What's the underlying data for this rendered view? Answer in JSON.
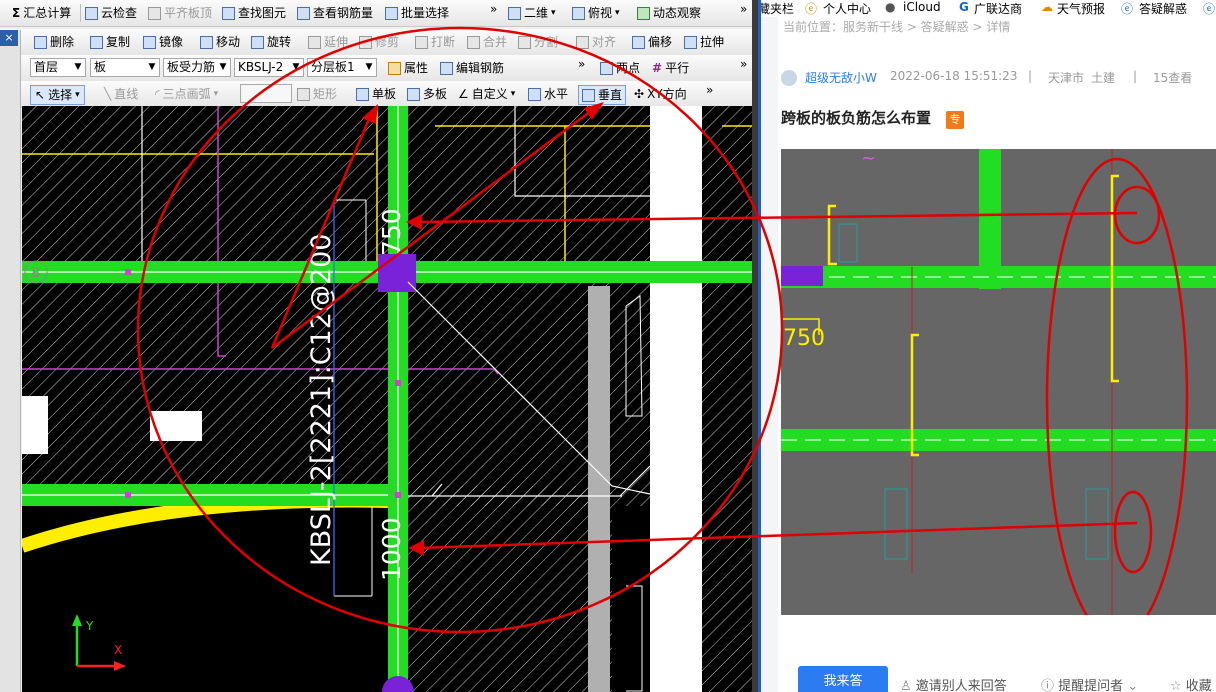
{
  "toolbar1": {
    "items": [
      "汇总计算",
      "云检查",
      "平齐板顶",
      "查找图元",
      "查看钢筋量",
      "批量选择",
      "二维",
      "俯视",
      "动态观察"
    ],
    "sigma": "Σ",
    "chevron": "»"
  },
  "toolbar2": {
    "items": [
      "删除",
      "复制",
      "镜像",
      "移动",
      "旋转",
      "延伸",
      "修剪",
      "打断",
      "合并",
      "分割",
      "对齐",
      "偏移",
      "拉伸"
    ]
  },
  "toolbar3": {
    "floor": "首层",
    "type": "板",
    "rebar": "板受力筋",
    "code": "KBSLJ-2",
    "layer": "分层板1",
    "property": "属性",
    "edit": "编辑钢筋",
    "twopoint": "两点",
    "parallel": "平行"
  },
  "toolbar4": {
    "items": [
      "选择",
      "直线",
      "三点画弧",
      "矩形",
      "单板",
      "多板",
      "自定义",
      "水平",
      "垂直",
      "XY方向"
    ]
  },
  "cad": {
    "axis_label": "B",
    "rebar_label": "KBSLJ-2[2221]:C12@200",
    "dim_top": "750",
    "dim_bottom": "1000",
    "y_axis": "Y",
    "x_axis": "X",
    "close": "×"
  },
  "browser": {
    "bookmarks": [
      "藏夹栏",
      "个人中心",
      "iCloud",
      "广联达商",
      "天气预报",
      "答疑解惑"
    ],
    "breadcrumb": "当前位置：服务新干线 > 答疑解惑 > 详情",
    "author": "超级无敌小W",
    "date": "2022-06-18 15:51:23",
    "region": "天津市",
    "discipline": "土建",
    "views": "15查看",
    "title": "跨板的板负筋怎么布置",
    "tag": "专",
    "answer_button": "我来答",
    "invite": "邀请别人来回答",
    "remind": "提醒提问者",
    "collect": "收藏",
    "img_dim": "750"
  },
  "colors": {
    "accent": "#2b7bf2",
    "beam_green": "#22dd22",
    "annotation_red": "#e00000",
    "rebar_yellow": "#ffee00",
    "magenta": "#d040d0"
  }
}
